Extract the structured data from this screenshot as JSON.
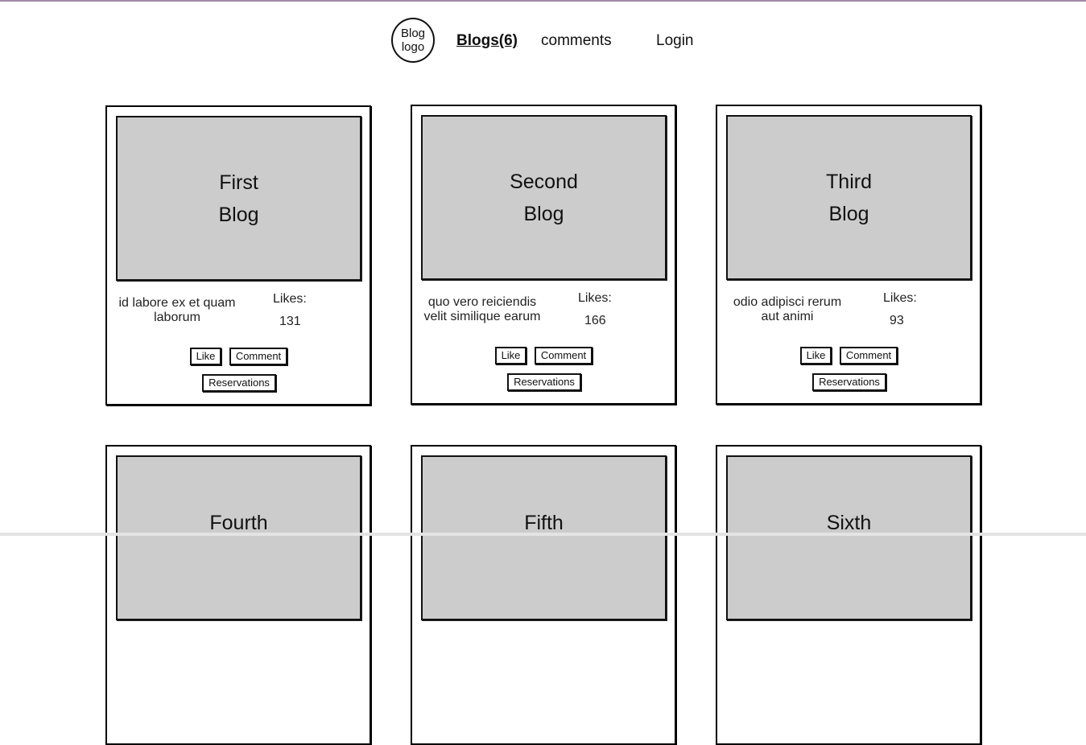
{
  "header": {
    "logo_line1": "Blog",
    "logo_line2": "logo",
    "nav": {
      "blogs": "Blogs(6)",
      "comments": "comments",
      "login": "Login"
    }
  },
  "cards": [
    {
      "title1": "First",
      "title2": "Blog",
      "description": "id labore ex et quam laborum",
      "likes_label": "Likes:",
      "likes": "131",
      "like_label": "Like",
      "comment_label": "Comment",
      "reservations_label": "Reservations"
    },
    {
      "title1": "Second",
      "title2": "Blog",
      "description": "quo vero reiciendis velit similique earum",
      "likes_label": "Likes:",
      "likes": "166",
      "like_label": "Like",
      "comment_label": "Comment",
      "reservations_label": "Reservations"
    },
    {
      "title1": "Third",
      "title2": "Blog",
      "description": "odio adipisci rerum aut animi",
      "likes_label": "Likes:",
      "likes": "93",
      "like_label": "Like",
      "comment_label": "Comment",
      "reservations_label": "Reservations"
    },
    {
      "title1": "Fourth"
    },
    {
      "title1": "Fifth"
    },
    {
      "title1": "Sixth"
    }
  ],
  "colors": {
    "image_placeholder": "#cccccc",
    "top_accent": "#a08aa6"
  }
}
